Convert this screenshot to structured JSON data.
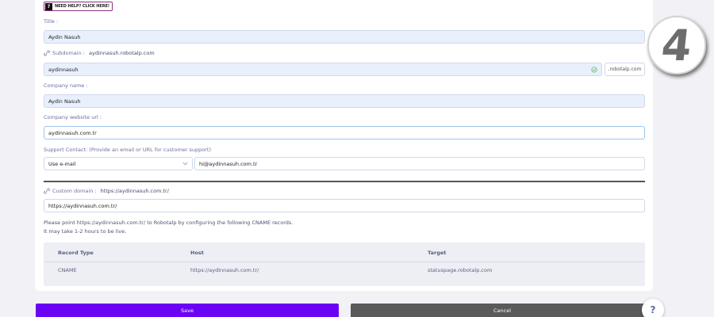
{
  "help_badge": {
    "icon": "question-icon",
    "text": "NEED HELP? CLICK HERE!"
  },
  "title": {
    "label": "Title :",
    "value": "Aydin Nasuh"
  },
  "subdomain": {
    "label": "Subdomain :",
    "link": "aydinnasuh.robotalp.com",
    "value": "aydinnasuh",
    "suffix": ".robotalp.com",
    "status_icon": "check-circle-icon"
  },
  "company_name": {
    "label": "Company name :",
    "value": "Aydin Nasuh"
  },
  "website": {
    "label": "Company website url :",
    "value": "aydinnasuh.com.tr"
  },
  "support": {
    "label": "Support Contact: (Provide an email or URL for customer support)",
    "type_value": "Use e-mail",
    "contact_value": "hi@aydinnasuh.com.tr"
  },
  "custom_domain": {
    "label": "Custom domain :",
    "link": "https://aydinnasuh.com.tr/",
    "value": "https://aydinnasuh.com.tr/"
  },
  "instructions": {
    "line1": "Please point https://aydinnasuh.com.tr/ to Robotalp by configuring the following CNAME records.",
    "line2": "It may take 1-2 hours to be live."
  },
  "cname_table": {
    "headers": [
      "Record Type",
      "Host",
      "Target"
    ],
    "rows": [
      [
        "CNAME",
        "https://aydinnasuh.com.tr/",
        "statuspage.robotalp.com"
      ]
    ]
  },
  "buttons": {
    "save": "Save",
    "cancel": "Cancel"
  },
  "help_fab": "?",
  "step_badge": "4",
  "colors": {
    "accent": "#6b04f5",
    "cancel": "#5a5a5a",
    "input_bg": "#e9f0fd",
    "success": "#4caf50"
  }
}
